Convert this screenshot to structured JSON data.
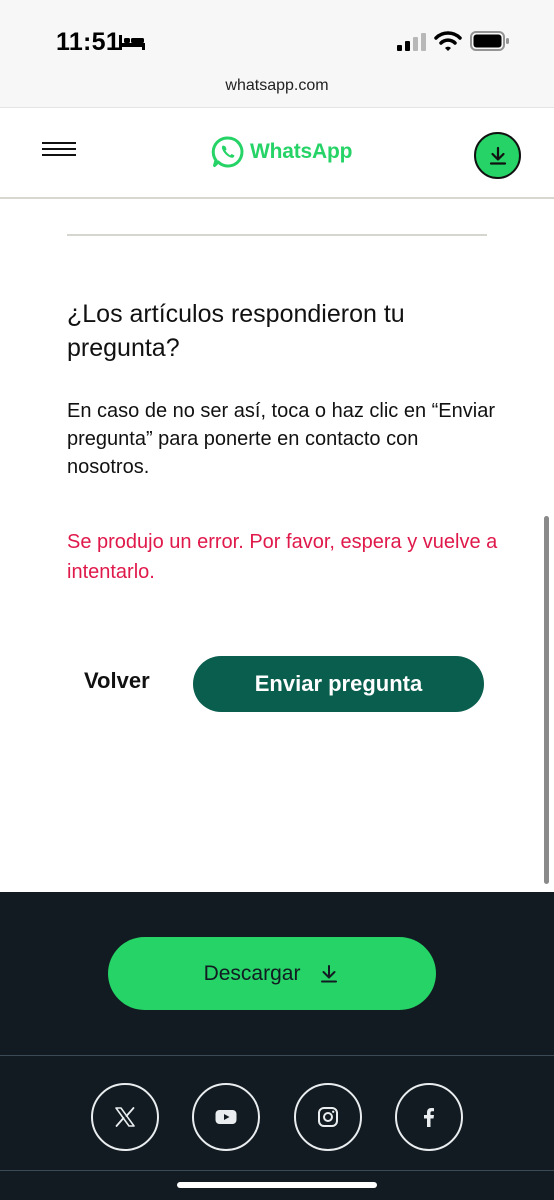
{
  "status_bar": {
    "time": "11:51",
    "icons": [
      "bed-icon",
      "signal-icon",
      "wifi-icon",
      "battery-icon"
    ]
  },
  "browser": {
    "url": "whatsapp.com"
  },
  "header": {
    "logo_text": "WhatsApp",
    "icons": [
      "menu-icon",
      "whatsapp-logo-icon",
      "download-icon"
    ]
  },
  "content": {
    "question": "¿Los artículos respondieron tu pregunta?",
    "help_text": "En caso de no ser así, toca o haz clic en “Enviar pregunta” para ponerte en contacto con nosotros.",
    "error_text": "Se produjo un error. Por favor, espera y vuelve a intentarlo.",
    "back_label": "Volver",
    "send_label": "Enviar pregunta"
  },
  "footer": {
    "download_label": "Descargar",
    "social_icons": [
      "x-icon",
      "youtube-icon",
      "instagram-icon",
      "facebook-icon"
    ]
  },
  "colors": {
    "brand_green": "#25d366",
    "dark_teal": "#0a5e4e",
    "footer_bg": "#111b21",
    "error_red": "#e0194b"
  }
}
